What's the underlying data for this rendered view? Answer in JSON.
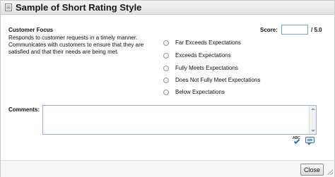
{
  "dialog": {
    "title": "Sample of Short Rating Style"
  },
  "competency": {
    "name": "Customer Focus",
    "description": "Responds to customer requests in a timely manner. Communicates with customers to ensure that they are satisfied and that their needs are being met."
  },
  "score": {
    "label": "Score:",
    "value": "",
    "max": "/ 5.0"
  },
  "ratings": [
    {
      "label": "Far Exceeds Expectations",
      "selected": false
    },
    {
      "label": "Exceeds Expectations",
      "selected": false
    },
    {
      "label": "Fully Meets Expectations",
      "selected": false
    },
    {
      "label": "Does Not Fully Meet Expectations",
      "selected": false
    },
    {
      "label": "Below Expectations",
      "selected": false
    }
  ],
  "comments": {
    "label": "Comments:",
    "value": ""
  },
  "tools": {
    "spellcheck_icon": "spellcheck-icon",
    "spellcheck_text": "ABC",
    "comment_icon": "comment-bubble-icon"
  },
  "footer": {
    "close_label": "Close"
  }
}
